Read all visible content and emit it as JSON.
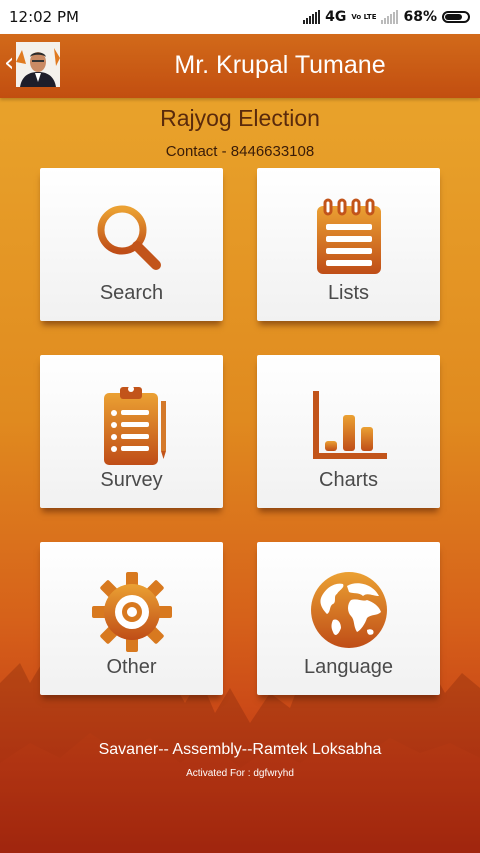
{
  "status_bar": {
    "time": "12:02 PM",
    "network": "4G",
    "volte": "Vo LTE",
    "battery_percent": "68%"
  },
  "header": {
    "title": "Mr. Krupal Tumane",
    "back_icon": "chevron-left-icon",
    "avatar": "profile-photo"
  },
  "app": {
    "name": "Rajyog Election",
    "contact": "Contact - 8446633108"
  },
  "tiles": [
    {
      "label": "Search",
      "icon": "search-icon"
    },
    {
      "label": "Lists",
      "icon": "notepad-list-icon"
    },
    {
      "label": "Survey",
      "icon": "clipboard-icon"
    },
    {
      "label": "Charts",
      "icon": "bar-chart-icon"
    },
    {
      "label": "Other",
      "icon": "gear-icon"
    },
    {
      "label": "Language",
      "icon": "globe-icon"
    }
  ],
  "footer": {
    "constituency": "Savaner-- Assembly--Ramtek Loksabha",
    "activated": "Activated For : dgfwryhd"
  },
  "colors": {
    "accent": "#c0521a",
    "icon_gradient_light": "#e8a030",
    "icon_gradient_dark": "#c0521a",
    "header": "#c85a14"
  }
}
